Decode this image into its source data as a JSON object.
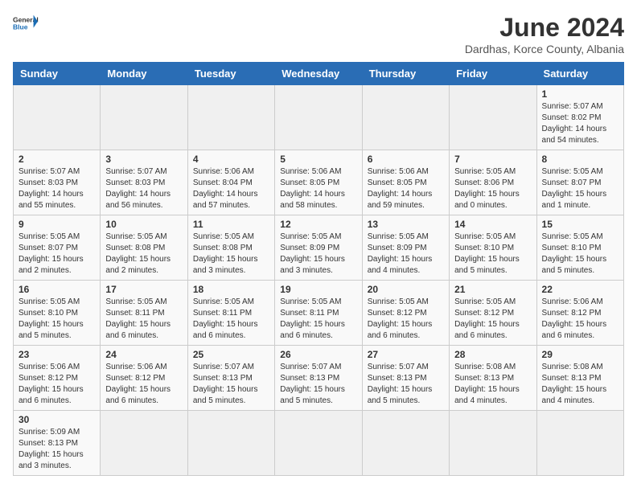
{
  "header": {
    "logo_general": "General",
    "logo_blue": "Blue",
    "month_title": "June 2024",
    "subtitle": "Dardhas, Korce County, Albania"
  },
  "weekdays": [
    "Sunday",
    "Monday",
    "Tuesday",
    "Wednesday",
    "Thursday",
    "Friday",
    "Saturday"
  ],
  "weeks": [
    [
      null,
      null,
      null,
      null,
      null,
      null,
      {
        "day": "1",
        "sunrise": "5:07 AM",
        "sunset": "8:02 PM",
        "daylight": "14 hours and 54 minutes."
      }
    ],
    [
      {
        "day": "2",
        "sunrise": "5:07 AM",
        "sunset": "8:03 PM",
        "daylight": "14 hours and 55 minutes."
      },
      {
        "day": "3",
        "sunrise": "5:07 AM",
        "sunset": "8:03 PM",
        "daylight": "14 hours and 56 minutes."
      },
      {
        "day": "4",
        "sunrise": "5:06 AM",
        "sunset": "8:04 PM",
        "daylight": "14 hours and 57 minutes."
      },
      {
        "day": "5",
        "sunrise": "5:06 AM",
        "sunset": "8:05 PM",
        "daylight": "14 hours and 58 minutes."
      },
      {
        "day": "6",
        "sunrise": "5:06 AM",
        "sunset": "8:05 PM",
        "daylight": "14 hours and 59 minutes."
      },
      {
        "day": "7",
        "sunrise": "5:05 AM",
        "sunset": "8:06 PM",
        "daylight": "15 hours and 0 minutes."
      },
      {
        "day": "8",
        "sunrise": "5:05 AM",
        "sunset": "8:07 PM",
        "daylight": "15 hours and 1 minute."
      }
    ],
    [
      {
        "day": "9",
        "sunrise": "5:05 AM",
        "sunset": "8:07 PM",
        "daylight": "15 hours and 2 minutes."
      },
      {
        "day": "10",
        "sunrise": "5:05 AM",
        "sunset": "8:08 PM",
        "daylight": "15 hours and 2 minutes."
      },
      {
        "day": "11",
        "sunrise": "5:05 AM",
        "sunset": "8:08 PM",
        "daylight": "15 hours and 3 minutes."
      },
      {
        "day": "12",
        "sunrise": "5:05 AM",
        "sunset": "8:09 PM",
        "daylight": "15 hours and 3 minutes."
      },
      {
        "day": "13",
        "sunrise": "5:05 AM",
        "sunset": "8:09 PM",
        "daylight": "15 hours and 4 minutes."
      },
      {
        "day": "14",
        "sunrise": "5:05 AM",
        "sunset": "8:10 PM",
        "daylight": "15 hours and 5 minutes."
      },
      {
        "day": "15",
        "sunrise": "5:05 AM",
        "sunset": "8:10 PM",
        "daylight": "15 hours and 5 minutes."
      }
    ],
    [
      {
        "day": "16",
        "sunrise": "5:05 AM",
        "sunset": "8:10 PM",
        "daylight": "15 hours and 5 minutes."
      },
      {
        "day": "17",
        "sunrise": "5:05 AM",
        "sunset": "8:11 PM",
        "daylight": "15 hours and 6 minutes."
      },
      {
        "day": "18",
        "sunrise": "5:05 AM",
        "sunset": "8:11 PM",
        "daylight": "15 hours and 6 minutes."
      },
      {
        "day": "19",
        "sunrise": "5:05 AM",
        "sunset": "8:11 PM",
        "daylight": "15 hours and 6 minutes."
      },
      {
        "day": "20",
        "sunrise": "5:05 AM",
        "sunset": "8:12 PM",
        "daylight": "15 hours and 6 minutes."
      },
      {
        "day": "21",
        "sunrise": "5:05 AM",
        "sunset": "8:12 PM",
        "daylight": "15 hours and 6 minutes."
      },
      {
        "day": "22",
        "sunrise": "5:06 AM",
        "sunset": "8:12 PM",
        "daylight": "15 hours and 6 minutes."
      }
    ],
    [
      {
        "day": "23",
        "sunrise": "5:06 AM",
        "sunset": "8:12 PM",
        "daylight": "15 hours and 6 minutes."
      },
      {
        "day": "24",
        "sunrise": "5:06 AM",
        "sunset": "8:12 PM",
        "daylight": "15 hours and 6 minutes."
      },
      {
        "day": "25",
        "sunrise": "5:07 AM",
        "sunset": "8:13 PM",
        "daylight": "15 hours and 5 minutes."
      },
      {
        "day": "26",
        "sunrise": "5:07 AM",
        "sunset": "8:13 PM",
        "daylight": "15 hours and 5 minutes."
      },
      {
        "day": "27",
        "sunrise": "5:07 AM",
        "sunset": "8:13 PM",
        "daylight": "15 hours and 5 minutes."
      },
      {
        "day": "28",
        "sunrise": "5:08 AM",
        "sunset": "8:13 PM",
        "daylight": "15 hours and 4 minutes."
      },
      {
        "day": "29",
        "sunrise": "5:08 AM",
        "sunset": "8:13 PM",
        "daylight": "15 hours and 4 minutes."
      }
    ],
    [
      {
        "day": "30",
        "sunrise": "5:09 AM",
        "sunset": "8:13 PM",
        "daylight": "15 hours and 3 minutes."
      },
      null,
      null,
      null,
      null,
      null,
      null
    ]
  ],
  "labels": {
    "sunrise": "Sunrise:",
    "sunset": "Sunset:",
    "daylight": "Daylight:"
  }
}
